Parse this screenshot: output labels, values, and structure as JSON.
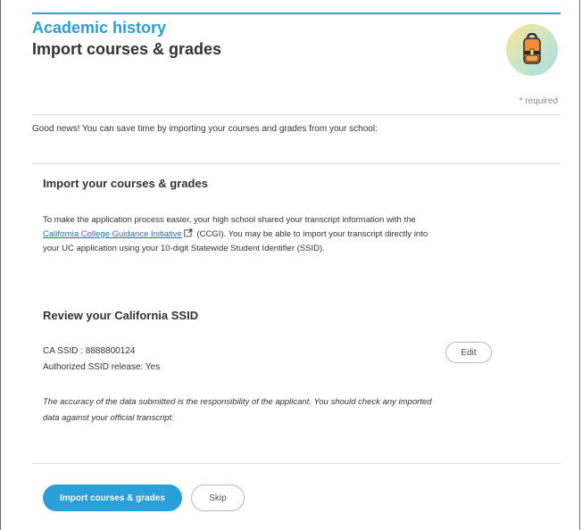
{
  "header": {
    "section_title": "Academic history",
    "page_title": "Import courses & grades",
    "avatar_icon": "backpack-icon",
    "required_note": "* required"
  },
  "intro": "Good news! You can save time by importing your courses and grades from your school:",
  "import_section": {
    "heading": "Import your courses & grades",
    "text_before_link": "To make the application process easier, your high school shared your transcript information with the ",
    "link_text": "California College Guidance Initiative",
    "link_icon": "external-link-icon",
    "text_after_link": " (CCGI). You may be able to import your transcript directly into your UC application using your 10-digit Statewide Student Identifier (SSID)."
  },
  "review_section": {
    "heading": "Review your California SSID",
    "ssid_line": "CA SSID : 8888800124",
    "release_line": "Authorized SSID release: Yes",
    "edit_label": "Edit",
    "note": "The accuracy of the data submitted is the responsibility of the applicant. You should check any imported data against your official transcript."
  },
  "actions": {
    "primary_label": "Import courses & grades",
    "skip_label": "Skip"
  },
  "colors": {
    "accent": "#2a9fd8",
    "link": "#1a72b8"
  }
}
